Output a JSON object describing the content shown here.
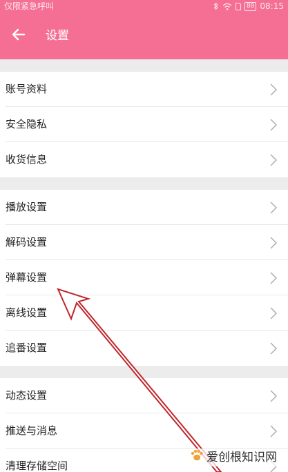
{
  "status_bar": {
    "carrier": "仅限紧急呼叫",
    "battery": "88",
    "time": "08:15"
  },
  "header": {
    "title": "设置",
    "back_icon": "arrow-left-icon"
  },
  "groups": [
    [
      "账号资料",
      "安全隐私",
      "收货信息"
    ],
    [
      "播放设置",
      "解码设置",
      "弹幕设置",
      "离线设置",
      "追番设置"
    ],
    [
      "动态设置",
      "推送与消息",
      "清理存储空间"
    ]
  ],
  "colors": {
    "accent": "#f56f95",
    "annotation_arrow": "#c0262b",
    "background": "#ececec"
  },
  "watermark": "爱创根知识网"
}
